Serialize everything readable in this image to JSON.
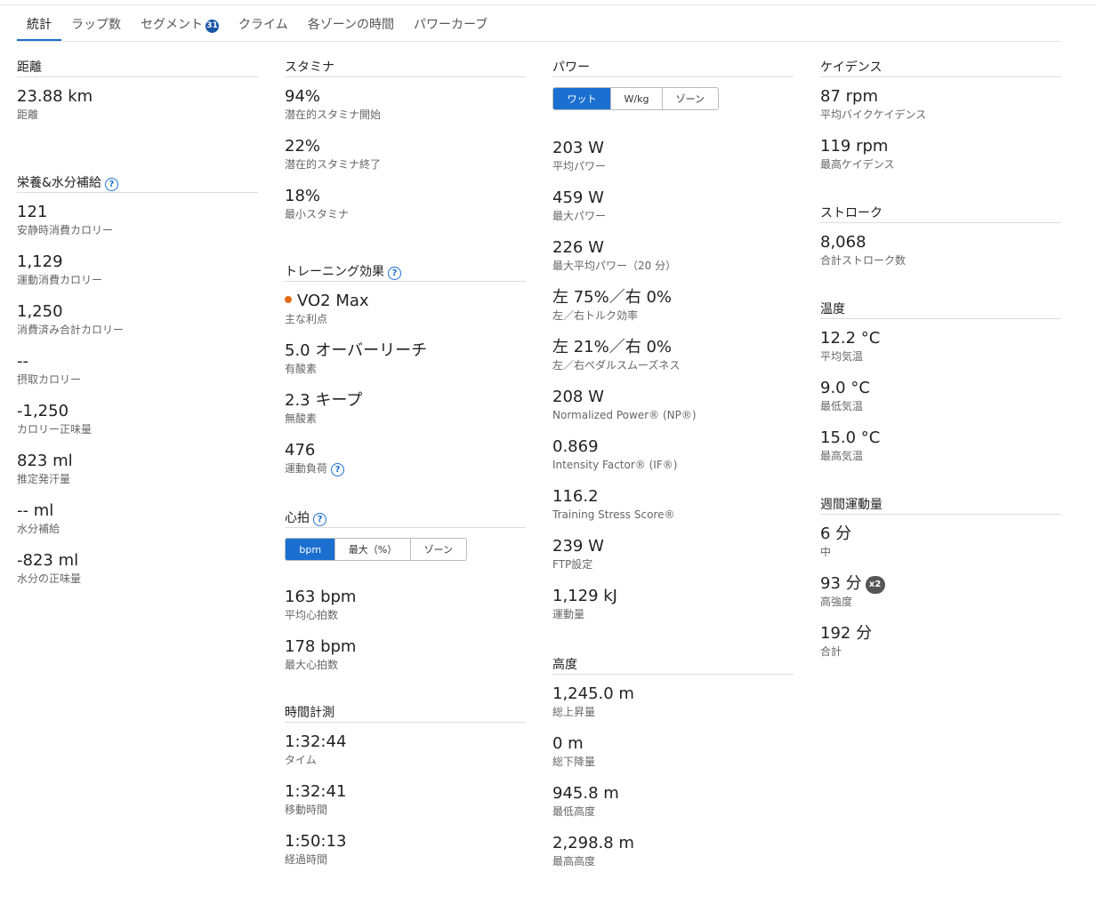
{
  "tabs": [
    {
      "label": "統計",
      "active": true
    },
    {
      "label": "ラップ数"
    },
    {
      "label": "セグメント",
      "badge": "31"
    },
    {
      "label": "クライム"
    },
    {
      "label": "各ゾーンの時間"
    },
    {
      "label": "パワーカーブ"
    }
  ],
  "distance": {
    "title": "距離",
    "value": "23.88 km",
    "label": "距離"
  },
  "nutrition": {
    "title": "栄養&水分補給",
    "stats": [
      {
        "value": "121",
        "label": "安静時消費カロリー"
      },
      {
        "value": "1,129",
        "label": "運動消費カロリー"
      },
      {
        "value": "1,250",
        "label": "消費済み合計カロリー"
      },
      {
        "value": "--",
        "label": "摂取カロリー"
      },
      {
        "value": "-1,250",
        "label": "カロリー正味量"
      },
      {
        "value": "823 ml",
        "label": "推定発汗量"
      },
      {
        "value": "-- ml",
        "label": "水分補給"
      },
      {
        "value": "-823 ml",
        "label": "水分の正味量"
      }
    ]
  },
  "stamina": {
    "title": "スタミナ",
    "stats": [
      {
        "value": "94%",
        "label": "潜在的スタミナ開始"
      },
      {
        "value": "22%",
        "label": "潜在的スタミナ終了"
      },
      {
        "value": "18%",
        "label": "最小スタミナ"
      }
    ]
  },
  "training": {
    "title": "トレーニング効果",
    "stats": [
      {
        "value": "VO2 Max",
        "label": "主な利点"
      },
      {
        "value": "5.0 オーバーリーチ",
        "label": "有酸素"
      },
      {
        "value": "2.3 キープ",
        "label": "無酸素"
      },
      {
        "value": "476",
        "label": "運動負荷"
      }
    ]
  },
  "heart": {
    "title": "心拍",
    "toggle": [
      "bpm",
      "最大（%）",
      "ゾーン"
    ],
    "stats": [
      {
        "value": "163 bpm",
        "label": "平均心拍数"
      },
      {
        "value": "178 bpm",
        "label": "最大心拍数"
      }
    ]
  },
  "timing": {
    "title": "時間計測",
    "stats": [
      {
        "value": "1:32:44",
        "label": "タイム"
      },
      {
        "value": "1:32:41",
        "label": "移動時間"
      },
      {
        "value": "1:50:13",
        "label": "経過時間"
      }
    ]
  },
  "power": {
    "title": "パワー",
    "toggle": [
      "ワット",
      "W/kg",
      "ゾーン"
    ],
    "stats": [
      {
        "value": "203 W",
        "label": "平均パワー"
      },
      {
        "value": "459 W",
        "label": "最大パワー"
      },
      {
        "value": "226 W",
        "label": "最大平均パワー（20 分）"
      },
      {
        "value": "左 75%／右 0%",
        "label": "左／右トルク効率"
      },
      {
        "value": "左 21%／右 0%",
        "label": "左／右ペダルスムーズネス"
      },
      {
        "value": "208 W",
        "label": "Normalized Power® (NP®)"
      },
      {
        "value": "0.869",
        "label": "Intensity Factor® (IF®)"
      },
      {
        "value": "116.2",
        "label": "Training Stress Score®"
      },
      {
        "value": "239 W",
        "label": "FTP設定"
      },
      {
        "value": "1,129 kJ",
        "label": "運動量"
      }
    ]
  },
  "elevation": {
    "title": "高度",
    "stats": [
      {
        "value": "1,245.0 m",
        "label": "総上昇量"
      },
      {
        "value": "0 m",
        "label": "総下降量"
      },
      {
        "value": "945.8 m",
        "label": "最低高度"
      },
      {
        "value": "2,298.8 m",
        "label": "最高高度"
      }
    ]
  },
  "cadence": {
    "title": "ケイデンス",
    "stats": [
      {
        "value": "87 rpm",
        "label": "平均バイクケイデンス"
      },
      {
        "value": "119 rpm",
        "label": "最高ケイデンス"
      }
    ]
  },
  "stroke": {
    "title": "ストローク",
    "stats": [
      {
        "value": "8,068",
        "label": "合計ストローク数"
      }
    ]
  },
  "temperature": {
    "title": "温度",
    "stats": [
      {
        "value": "12.2 °C",
        "label": "平均気温"
      },
      {
        "value": "9.0 °C",
        "label": "最低気温"
      },
      {
        "value": "15.0 °C",
        "label": "最高気温"
      }
    ]
  },
  "weekly": {
    "title": "週間運動量",
    "stats": [
      {
        "value": "6 分",
        "label": "中"
      },
      {
        "value": "93 分",
        "label": "高強度",
        "multiplier": "x2"
      },
      {
        "value": "192 分",
        "label": "合計"
      }
    ]
  },
  "colors": {
    "accent": "#1a6fd0",
    "dot": "#e56a1c",
    "badge": "#1a56a8"
  }
}
